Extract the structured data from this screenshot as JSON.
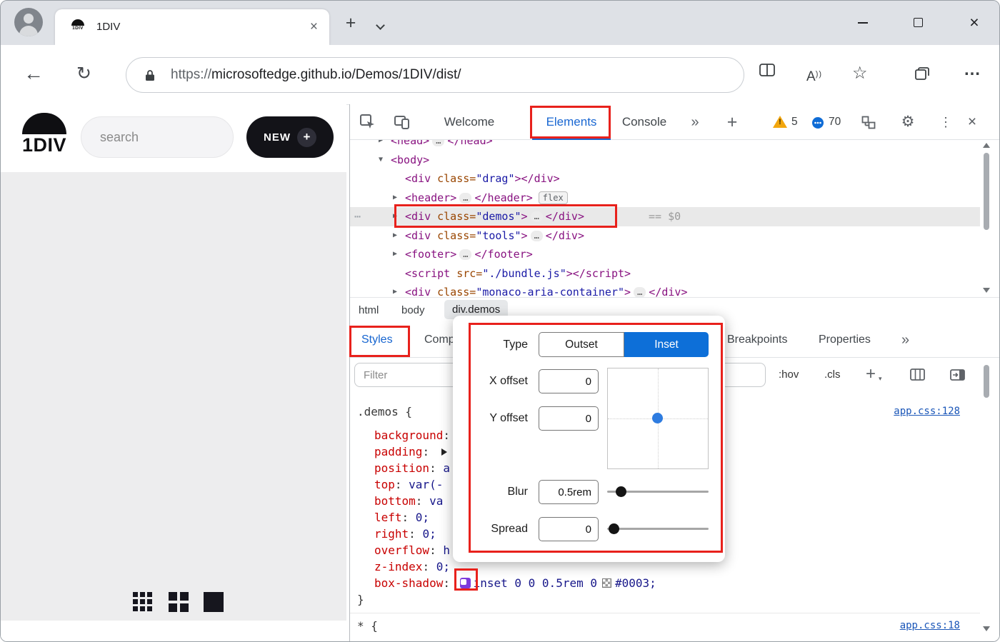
{
  "icons": {
    "back": "←",
    "refresh": "↻",
    "star": "☆",
    "more": "…",
    "plus": "+",
    "close": "×",
    "gear": "⚙",
    "kebab": "⋮",
    "chevrons": "»",
    "collapse": "▼",
    "expand": "▶",
    "ellipsis": "…",
    "grip": "⋯",
    "caret_down": "▾",
    "read_aloud": "A",
    "read_aloud_marks": "))"
  },
  "browser": {
    "tab_title": "1DIV",
    "favicon_text": "1DIV",
    "url_scheme": "https://",
    "url_host": "microsoftedge.github.io",
    "url_path": "/Demos/1DIV/dist/"
  },
  "app": {
    "logo_text": "1DIV",
    "search_placeholder": "search",
    "new_label": "NEW",
    "new_plus": "+"
  },
  "devtools": {
    "tabs": {
      "welcome": "Welcome",
      "elements": "Elements",
      "console": "Console"
    },
    "warning_count": "5",
    "issues_count": "70",
    "dom": {
      "head_open": "<head>",
      "head_close": "</head>",
      "body_open": "<body>",
      "tag_div": "<div",
      "attr_class": "class=",
      "drag_value": "\"drag\"",
      "gt": ">",
      "gt_close_div": "></div>",
      "div_close": "</div>",
      "header_open": "<header>",
      "header_close": "</header>",
      "flex_badge": "flex",
      "demos_value": "\"demos\"",
      "selected_hint": "== $0",
      "tools_value": "\"tools\"",
      "footer_open": "<footer>",
      "footer_close": "</footer>",
      "script_open": "<script",
      "attr_src": "src=",
      "script_value": "\"./bundle.js\"",
      "script_close": "</script>",
      "monaco_value": "\"monaco-aria-container\""
    },
    "breadcrumb": [
      "html",
      "body",
      "div.demos"
    ],
    "styles": {
      "tabs": [
        "Styles",
        "Computed",
        "Breakpoints",
        "Properties"
      ],
      "overflow": "»",
      "filter_placeholder": "Filter",
      "hov": ":hov",
      "cls": ".cls",
      "new_rule": "+",
      "colon": ": ",
      "rule_demos": {
        "selector": ".demos {",
        "source": "app.css:128",
        "close": "}",
        "props": [
          {
            "name": "background",
            "value": ""
          },
          {
            "name": "padding",
            "value": ""
          },
          {
            "name": "position",
            "value": "a"
          },
          {
            "name": "top",
            "value": "var(-"
          },
          {
            "name": "bottom",
            "value": "va"
          },
          {
            "name": "left",
            "value": "0;"
          },
          {
            "name": "right",
            "value": "0;"
          },
          {
            "name": "overflow",
            "value": "h"
          },
          {
            "name": "z-index",
            "value": "0;"
          },
          {
            "name": "box-shadow",
            "value": "inset 0 0 0.5rem 0",
            "color": "#0003;"
          }
        ]
      },
      "rule_universal": {
        "selector": "* {",
        "source": "app.css:18"
      }
    },
    "shadow_editor": {
      "type_label": "Type",
      "outset": "Outset",
      "inset": "Inset",
      "x_label": "X offset",
      "x_value": "0",
      "y_label": "Y offset",
      "y_value": "0",
      "blur_label": "Blur",
      "blur_value": "0.5rem",
      "spread_label": "Spread",
      "spread_value": "0"
    }
  }
}
